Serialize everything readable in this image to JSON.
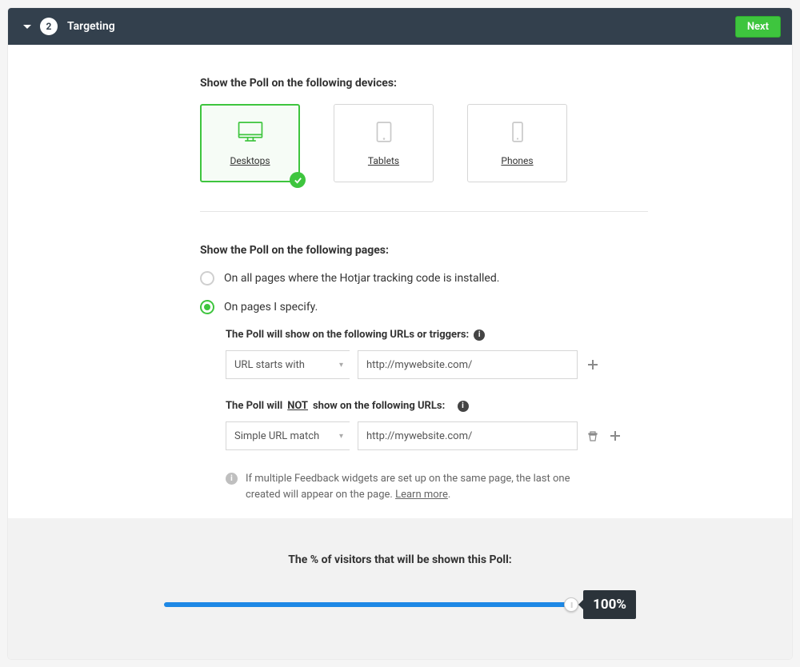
{
  "header": {
    "step_number": "2",
    "title": "Targeting",
    "next_label": "Next"
  },
  "devices": {
    "heading": "Show the Poll on the following devices:",
    "options": [
      {
        "label": "Desktops",
        "selected": true
      },
      {
        "label": "Tablets",
        "selected": false
      },
      {
        "label": "Phones",
        "selected": false
      }
    ]
  },
  "pages": {
    "heading": "Show the Poll on the following pages:",
    "radio_all": "On all pages where the Hotjar tracking code is installed.",
    "radio_specific": "On pages I specify.",
    "include": {
      "heading": "The Poll will show on the following URLs or triggers:",
      "match_type": "URL starts with",
      "url": "http://mywebsite.com/"
    },
    "exclude": {
      "heading_pre": "The Poll will ",
      "heading_not": "NOT",
      "heading_post": " show on the following URLs:",
      "match_type": "Simple URL match",
      "url": "http://mywebsite.com/"
    },
    "note_text": "If multiple Feedback widgets are set up on the same page, the last one created will appear on the page. ",
    "learn_more": "Learn more"
  },
  "slider": {
    "heading": "The % of visitors that will be shown this Poll:",
    "value": "100%"
  }
}
